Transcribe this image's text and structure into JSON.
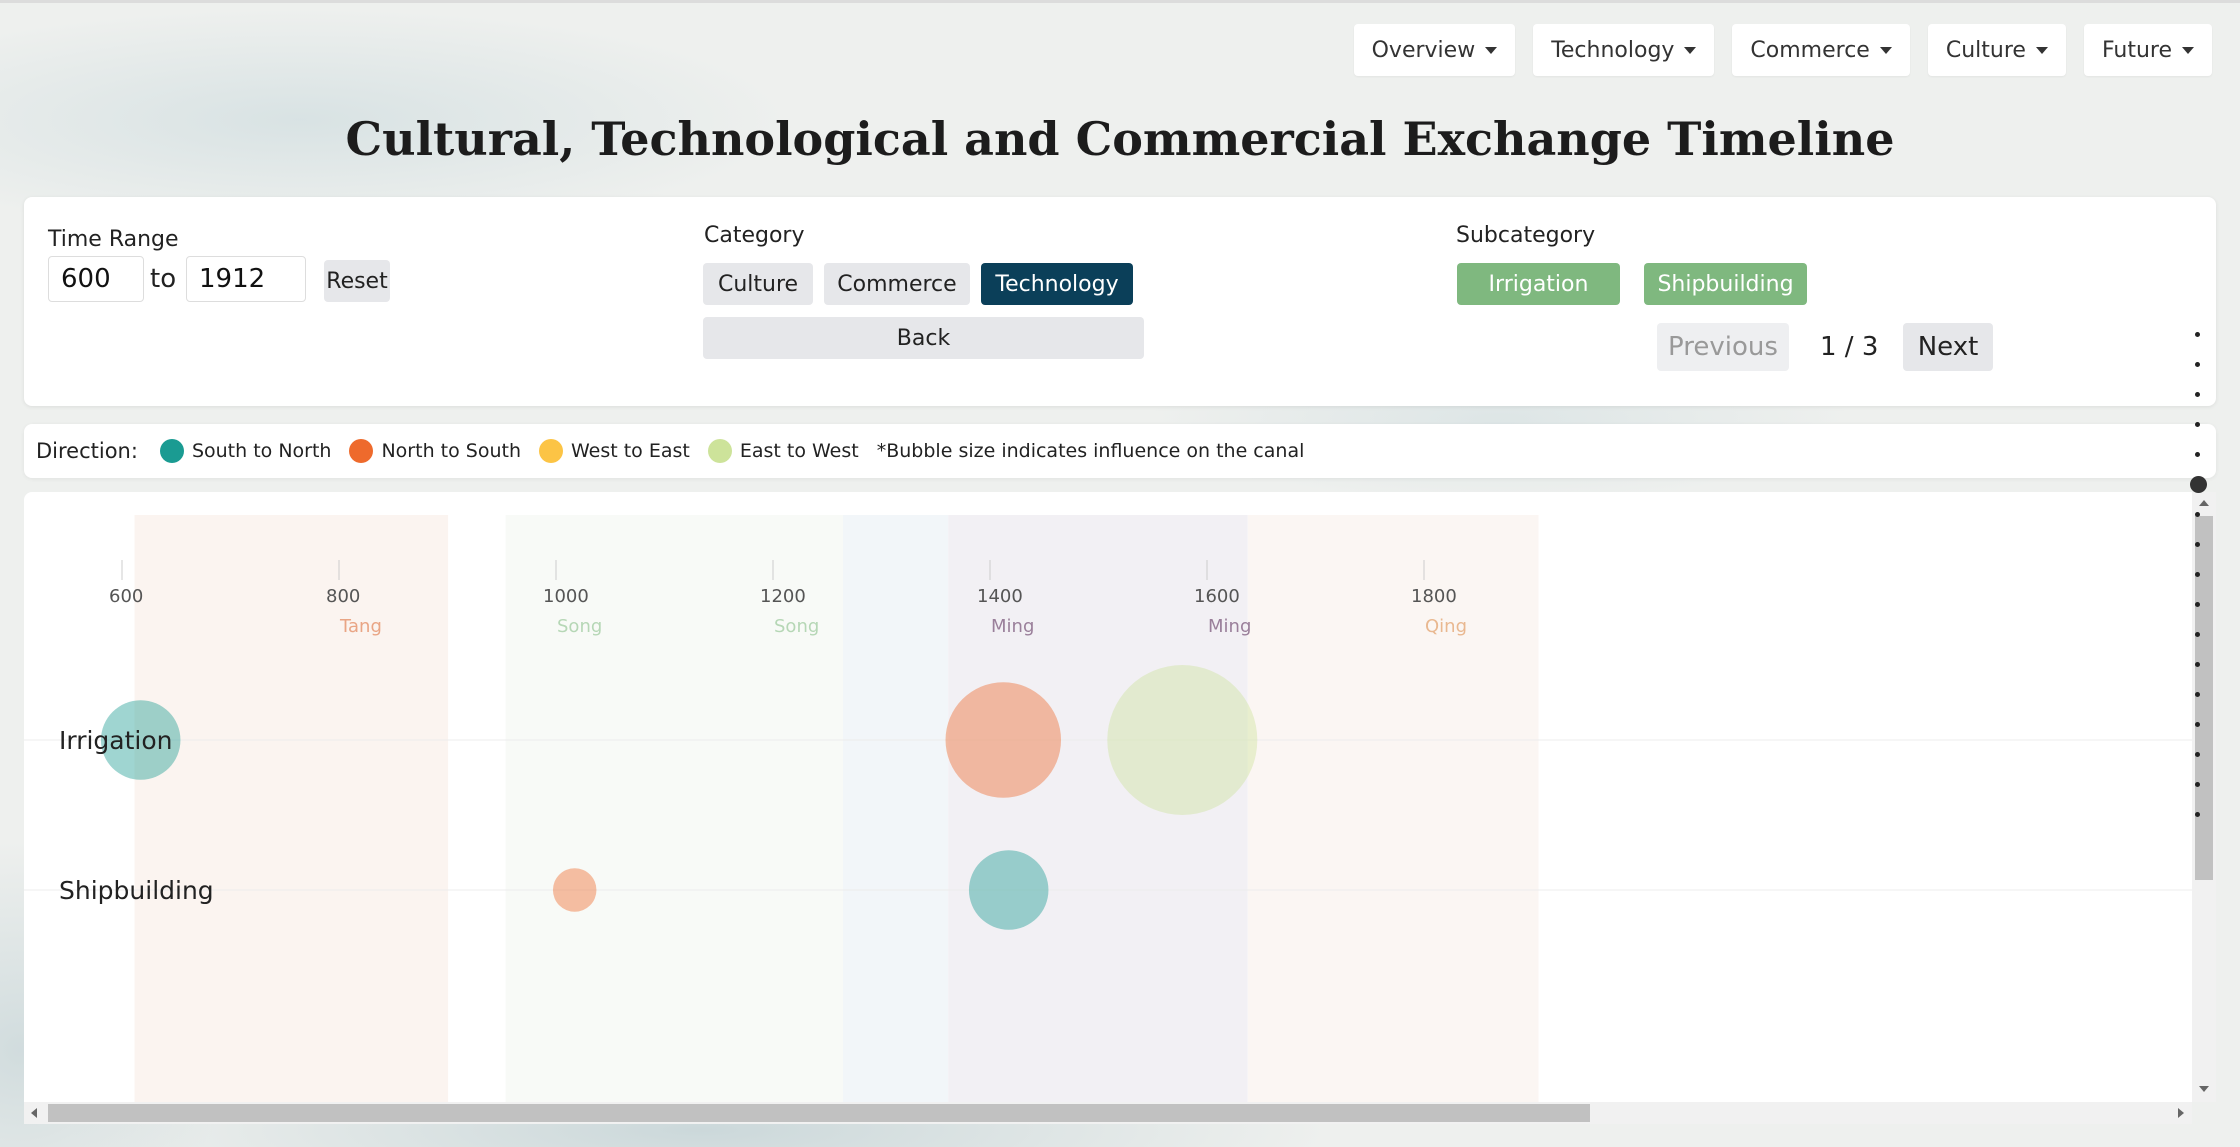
{
  "nav": {
    "items": [
      {
        "label": "Overview"
      },
      {
        "label": "Technology"
      },
      {
        "label": "Commerce"
      },
      {
        "label": "Culture"
      },
      {
        "label": "Future"
      }
    ]
  },
  "title": "Cultural, Technological and Commercial Exchange Timeline",
  "filters": {
    "time_range_label": "Time Range",
    "from": "600",
    "to_label": "to",
    "to": "1912",
    "reset_label": "Reset",
    "category_label": "Category",
    "categories": [
      "Culture",
      "Commerce",
      "Technology"
    ],
    "selected_category": "Technology",
    "back_label": "Back",
    "subcategory_label": "Subcategory",
    "subcategories": [
      "Irrigation",
      "Shipbuilding"
    ],
    "previous_label": "Previous",
    "page_indicator": "1 / 3",
    "next_label": "Next"
  },
  "legend": {
    "label": "Direction:",
    "items": [
      {
        "label": "South to North",
        "color": "#1a9b92"
      },
      {
        "label": "North to South",
        "color": "#ee6a2c"
      },
      {
        "label": "West to East",
        "color": "#fcc445"
      },
      {
        "label": "East to West",
        "color": "#cde39a"
      }
    ],
    "note": "*Bubble size indicates influence on the canal"
  },
  "chart_data": {
    "type": "scatter",
    "x_ticks": [
      600,
      800,
      1000,
      1200,
      1400,
      1600,
      1800
    ],
    "dynasty_labels": [
      {
        "year": 800,
        "label": "Tang",
        "color": "#e9a585"
      },
      {
        "year": 1000,
        "label": "Song",
        "color": "#b6d7b6"
      },
      {
        "year": 1200,
        "label": "Song",
        "color": "#b6d7b6"
      },
      {
        "year": 1400,
        "label": "Ming",
        "color": "#9a7f9a"
      },
      {
        "year": 1600,
        "label": "Ming",
        "color": "#9a7f9a"
      },
      {
        "year": 1800,
        "label": "Qing",
        "color": "#e9b890"
      }
    ],
    "eras": [
      {
        "start": 618,
        "end": 907,
        "color": "#fbf4f0"
      },
      {
        "start": 960,
        "end": 1271,
        "color": "#f8faf7"
      },
      {
        "start": 1271,
        "end": 1368,
        "color": "#f2f6f9"
      },
      {
        "start": 1368,
        "end": 1644,
        "color": "#f2f0f4"
      },
      {
        "start": 1644,
        "end": 1912,
        "color": "#fbf6f3"
      }
    ],
    "rows": [
      "Irrigation",
      "Shipbuilding"
    ],
    "points": [
      {
        "row": "Irrigation",
        "year": 620,
        "direction": "South to North",
        "size": 0.53
      },
      {
        "row": "Irrigation",
        "year": 1415,
        "direction": "North to South",
        "size": 0.77
      },
      {
        "row": "Irrigation",
        "year": 1580,
        "direction": "East to West",
        "size": 1.0
      },
      {
        "row": "Shipbuilding",
        "year": 1020,
        "direction": "North to South",
        "size": 0.29
      },
      {
        "row": "Shipbuilding",
        "year": 1420,
        "direction": "South to North",
        "size": 0.53
      }
    ]
  }
}
